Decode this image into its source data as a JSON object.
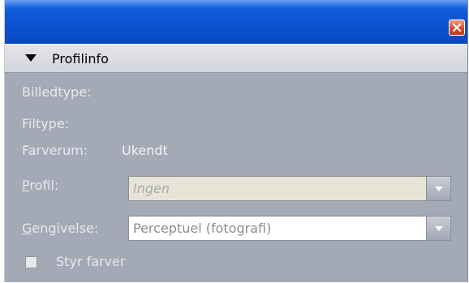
{
  "titlebar": {
    "close_icon": "close-x-icon",
    "close_color": "#d8472a"
  },
  "section": {
    "title": "Profilinfo",
    "icon": "triangle-down-icon"
  },
  "fields": {
    "billedtype_label": "Billedtype:",
    "filtype_label": "Filtype:",
    "farverum_label": "Farverum:",
    "farverum_value": "Ukendt",
    "profil_label_first": "P",
    "profil_label_rest": "rofil:",
    "profil_value": "Ingen",
    "gengivelse_label_first": "G",
    "gengivelse_label_rest": "engivelse:",
    "gengivelse_value": "Perceptuel (fotografi)"
  },
  "checkbox": {
    "label": "Styr farver",
    "checked": false
  },
  "colors": {
    "title_bar": "#0b50cc",
    "panel": "#a3a9b5",
    "header": "#d2d5dc",
    "disabled_combo_bg": "#e6e4d6"
  }
}
